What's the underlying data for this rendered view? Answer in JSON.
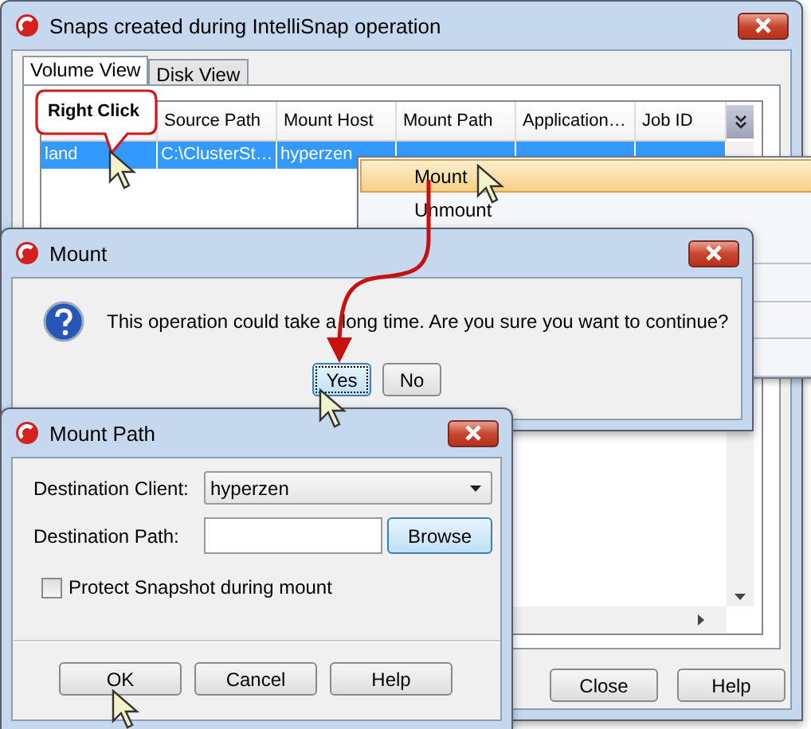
{
  "main_window": {
    "title": "Snaps created during IntelliSnap operation",
    "tabs": [
      {
        "label": "Volume View",
        "selected": true
      },
      {
        "label": "Disk View",
        "selected": false
      }
    ],
    "table": {
      "columns": [
        "",
        "Source Path",
        "Mount Host",
        "Mount Path",
        "Application…",
        "Job ID"
      ],
      "rows": [
        {
          "selected": true,
          "cells": [
            "land",
            "C:\\ClusterSt…",
            "hyperzen"
          ]
        }
      ]
    },
    "buttons": [
      "Close",
      "Help"
    ]
  },
  "callout": "Right Click",
  "context_menu": {
    "items": [
      {
        "label": "Mount",
        "selected": true
      },
      {
        "label": "Unmount",
        "selected": false
      }
    ]
  },
  "mount_dialog": {
    "title": "Mount",
    "message": "This operation could take a long time. Are you sure you want to continue?",
    "buttons": [
      {
        "label": "Yes",
        "focused": true
      },
      {
        "label": "No",
        "focused": false
      }
    ]
  },
  "mount_path_dialog": {
    "title": "Mount Path",
    "destination_client": {
      "label": "Destination Client:",
      "value": "hyperzen"
    },
    "destination_path": {
      "label": "Destination Path:",
      "button": "Browse"
    },
    "protect_snapshot": {
      "label": "Protect Snapshot during mount",
      "checked": false
    },
    "buttons": [
      "OK",
      "Cancel",
      "Help"
    ]
  }
}
